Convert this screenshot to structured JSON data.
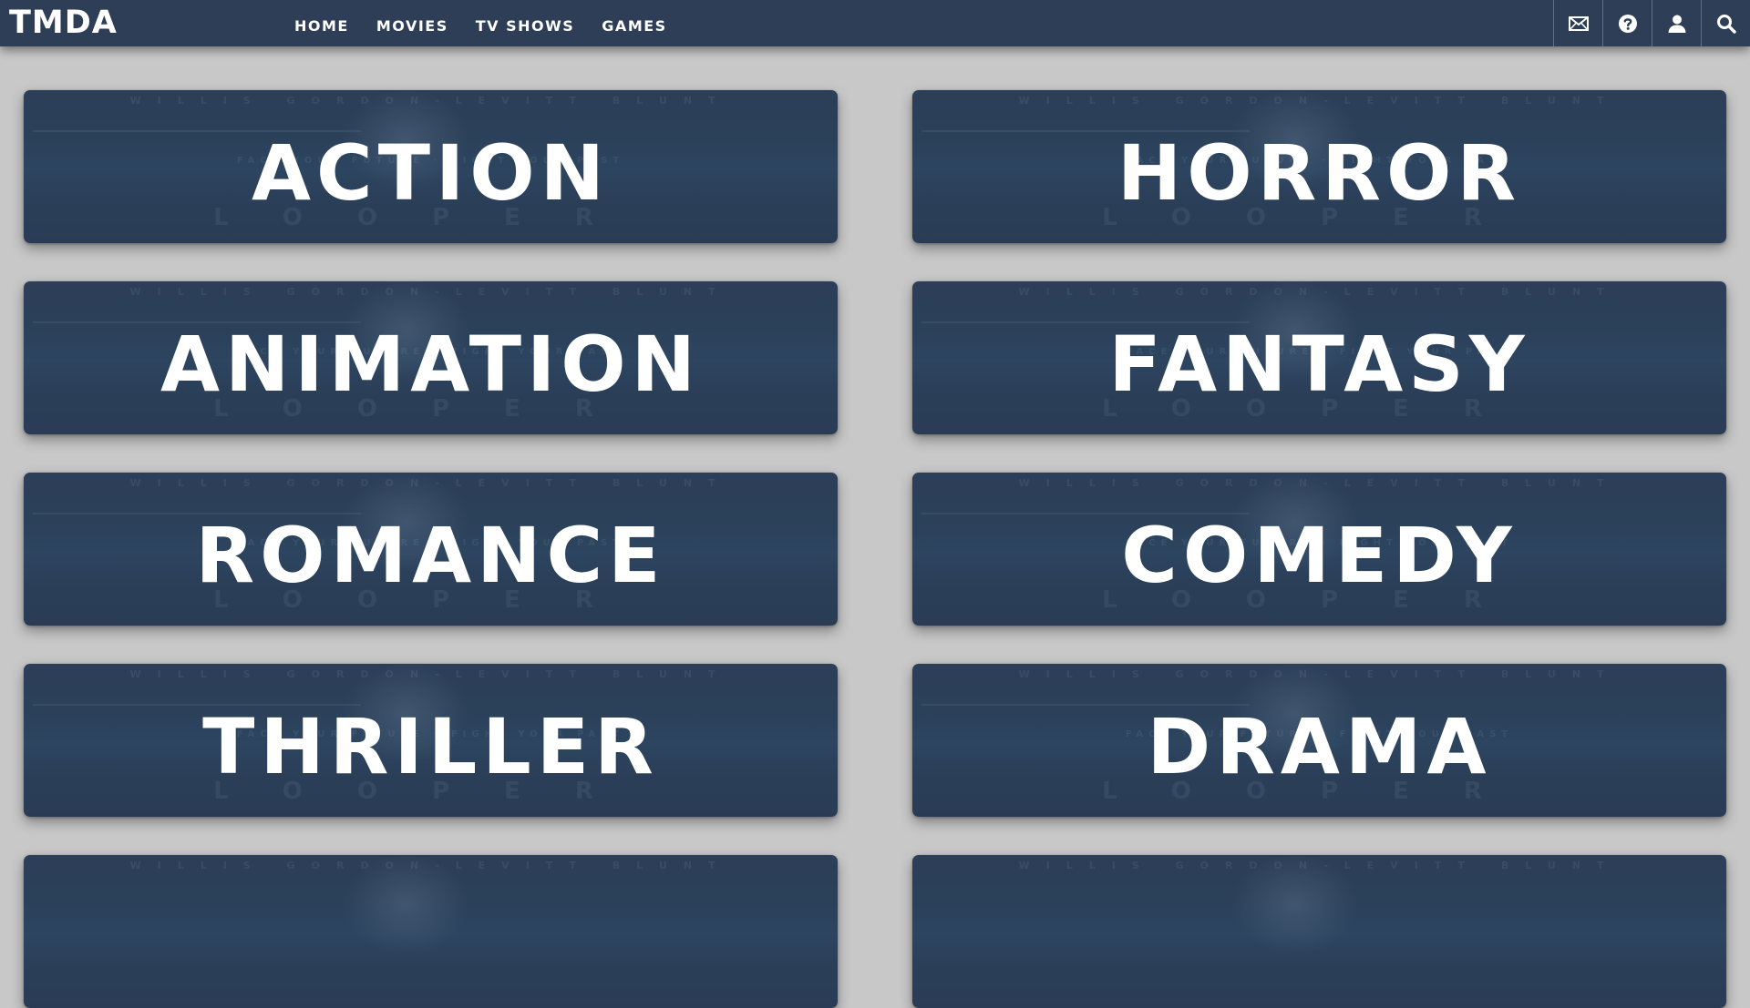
{
  "header": {
    "logo": "TMDA",
    "nav": [
      {
        "label": "HOME"
      },
      {
        "label": "MOVIES"
      },
      {
        "label": "TV SHOWS"
      },
      {
        "label": "GAMES"
      }
    ],
    "icons": [
      "mail-icon",
      "help-icon",
      "user-icon",
      "search-icon"
    ]
  },
  "genres": [
    {
      "label": "ACTION"
    },
    {
      "label": "HORROR"
    },
    {
      "label": "ANIMATION"
    },
    {
      "label": "FANTASY"
    },
    {
      "label": "ROMANCE"
    },
    {
      "label": "COMEDY"
    },
    {
      "label": "THRILLER"
    },
    {
      "label": "DRAMA"
    },
    {
      "label": ""
    },
    {
      "label": ""
    }
  ],
  "colors": {
    "header_bg": "#2e3e56",
    "page_bg": "#c8c8c8",
    "card_bg": "#2c3f59",
    "text": "#ffffff"
  }
}
